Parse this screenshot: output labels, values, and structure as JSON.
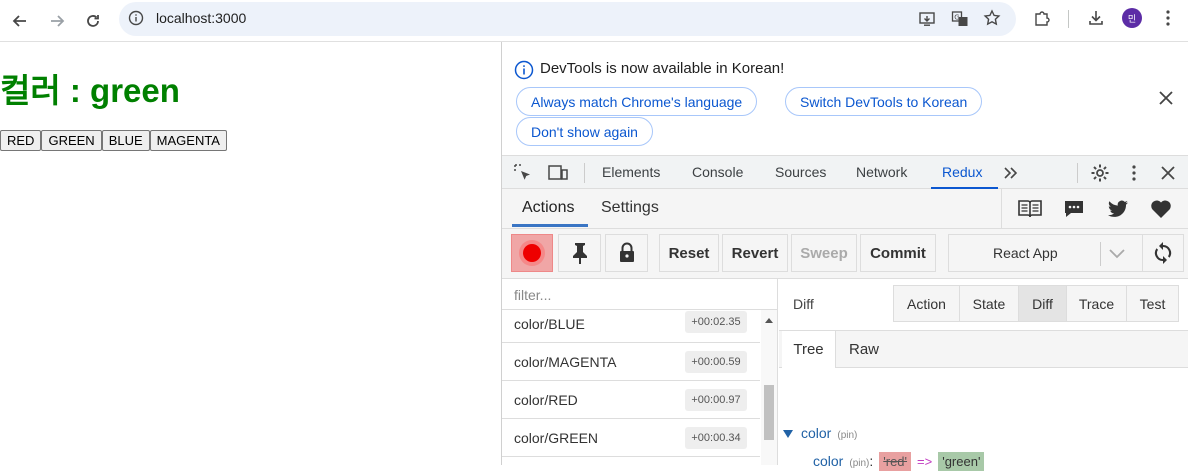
{
  "browser": {
    "url": "localhost:3000",
    "avatar_initial": "민"
  },
  "page": {
    "title": "컬러 : green",
    "buttons": [
      "RED",
      "GREEN",
      "BLUE",
      "MAGENTA"
    ]
  },
  "infobar": {
    "message": "DevTools is now available in Korean!",
    "match_label": "Always match Chrome's language",
    "switch_label": "Switch DevTools to Korean",
    "dont_show_label": "Don't show again"
  },
  "devtools_tabs": [
    "Elements",
    "Console",
    "Sources",
    "Network",
    "Redux"
  ],
  "redux": {
    "header_tabs": [
      "Actions",
      "Settings"
    ],
    "toolbar": {
      "reset": "Reset",
      "revert": "Revert",
      "sweep": "Sweep",
      "commit": "Commit",
      "instance": "React App"
    },
    "filter_placeholder": "filter...",
    "actions": [
      {
        "name": "color/BLUE",
        "time": "+00:02.35"
      },
      {
        "name": "color/MAGENTA",
        "time": "+00:00.59"
      },
      {
        "name": "color/RED",
        "time": "+00:00.97"
      },
      {
        "name": "color/GREEN",
        "time": "+00:00.34"
      }
    ],
    "detail": {
      "label": "Diff",
      "mode_tabs": [
        "Action",
        "State",
        "Diff",
        "Trace",
        "Test"
      ],
      "active_mode": "Diff",
      "sub_tabs": [
        "Tree",
        "Raw"
      ],
      "tree_root_key": "color",
      "tree_child_key": "color",
      "pin_label": "(pin)",
      "old_value": "'red'",
      "new_value": "'green'",
      "arrow": "=>"
    }
  },
  "colors": {
    "title_green": "#008000",
    "devtools_accent": "#0b57d0",
    "record_red": "#e00000"
  }
}
